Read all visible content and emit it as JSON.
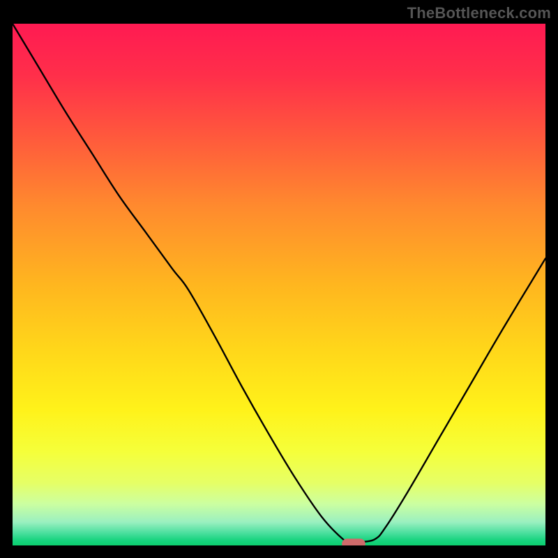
{
  "watermark": "TheBottleneck.com",
  "chart_data": {
    "type": "line",
    "title": "",
    "xlabel": "",
    "ylabel": "",
    "xlim": [
      0,
      100
    ],
    "ylim": [
      0,
      100
    ],
    "grid": false,
    "legend": false,
    "series": [
      {
        "name": "curve",
        "x": [
          0,
          5,
          10,
          15,
          20,
          25,
          30,
          33,
          38,
          43,
          48,
          53,
          58,
          62,
          63.5,
          65,
          68,
          70,
          74,
          80,
          86,
          92,
          100
        ],
        "y": [
          100,
          91.5,
          83,
          75,
          67,
          60,
          53,
          49,
          40,
          30.5,
          21.5,
          13,
          5.5,
          1.2,
          0.6,
          0.6,
          1.2,
          3.5,
          10,
          20.5,
          31,
          41.5,
          55
        ]
      }
    ],
    "marker": {
      "x": 64,
      "y": 0.3,
      "rx": 2.2,
      "ry": 1.0,
      "color": "#cf6b6b"
    },
    "gradient_stops": [
      {
        "pos": 0.0,
        "color": "#ff1a52"
      },
      {
        "pos": 0.1,
        "color": "#ff2f4a"
      },
      {
        "pos": 0.22,
        "color": "#ff5a3c"
      },
      {
        "pos": 0.35,
        "color": "#ff8a2e"
      },
      {
        "pos": 0.5,
        "color": "#ffb61f"
      },
      {
        "pos": 0.63,
        "color": "#ffd81a"
      },
      {
        "pos": 0.74,
        "color": "#fff21a"
      },
      {
        "pos": 0.82,
        "color": "#f5ff3a"
      },
      {
        "pos": 0.88,
        "color": "#e6ff66"
      },
      {
        "pos": 0.92,
        "color": "#ccffa0"
      },
      {
        "pos": 0.955,
        "color": "#9bf0c0"
      },
      {
        "pos": 0.975,
        "color": "#4fe0a0"
      },
      {
        "pos": 0.99,
        "color": "#18d47f"
      },
      {
        "pos": 1.0,
        "color": "#0bcf6e"
      }
    ]
  }
}
